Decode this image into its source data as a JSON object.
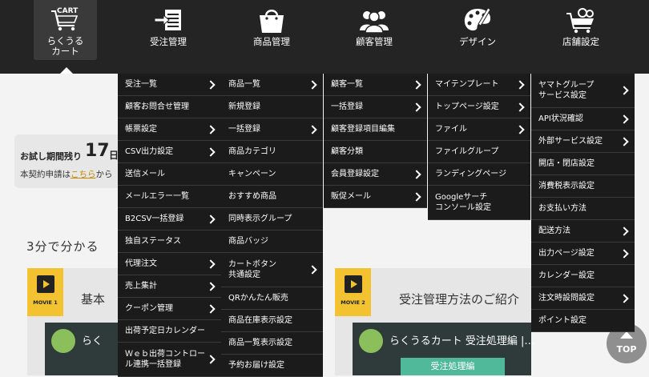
{
  "nav": [
    {
      "id": "cart",
      "label": "らくうる\nカート",
      "icon": "cart-icon",
      "icon_text": "CART"
    },
    {
      "id": "orders",
      "label": "受注管理",
      "icon": "order-import-icon"
    },
    {
      "id": "products",
      "label": "商品管理",
      "icon": "shopping-bag-icon"
    },
    {
      "id": "customers",
      "label": "顧客管理",
      "icon": "users-icon"
    },
    {
      "id": "design",
      "label": "デザイン",
      "icon": "palette-icon"
    },
    {
      "id": "store",
      "label": "店舗設定",
      "icon": "cart-settings-icon"
    }
  ],
  "menus": [
    {
      "id": "orders",
      "items": [
        {
          "label": "受注一覧",
          "arrow": true
        },
        {
          "label": "顧客お問合せ管理",
          "arrow": false
        },
        {
          "label": "帳票設定",
          "arrow": true
        },
        {
          "label": "CSV出力設定",
          "arrow": true
        },
        {
          "label": "送信メール",
          "arrow": false
        },
        {
          "label": "メールエラー一覧",
          "arrow": false
        },
        {
          "label": "B2CSV一括登録",
          "arrow": true
        },
        {
          "label": "独自ステータス",
          "arrow": false
        },
        {
          "label": "代理注文",
          "arrow": true
        },
        {
          "label": "売上集計",
          "arrow": true
        },
        {
          "label": "クーポン管理",
          "arrow": true
        },
        {
          "label": "出荷予定日カレンダー",
          "arrow": false
        },
        {
          "label": "Ｗｅｂ出荷コントロー\nル連携一括登録",
          "arrow": true,
          "tall": true
        }
      ]
    },
    {
      "id": "products",
      "items": [
        {
          "label": "商品一覧",
          "arrow": true
        },
        {
          "label": "新規登録",
          "arrow": false
        },
        {
          "label": "一括登録",
          "arrow": true
        },
        {
          "label": "商品カテゴリ",
          "arrow": false
        },
        {
          "label": "キャンペーン",
          "arrow": false
        },
        {
          "label": "おすすめ商品",
          "arrow": false
        },
        {
          "label": "同時表示グループ",
          "arrow": false
        },
        {
          "label": "商品バッジ",
          "arrow": false
        },
        {
          "label": "カートボタン\n共通設定",
          "arrow": true,
          "tall": true
        },
        {
          "label": "QRかんたん販売",
          "arrow": false
        },
        {
          "label": "商品在庫表示設定",
          "arrow": false
        },
        {
          "label": "商品一覧表示設定",
          "arrow": false
        },
        {
          "label": "予約お届け設定",
          "arrow": false
        }
      ]
    },
    {
      "id": "customers",
      "items": [
        {
          "label": "顧客一覧",
          "arrow": true
        },
        {
          "label": "一括登録",
          "arrow": true
        },
        {
          "label": "顧客登録項目編集",
          "arrow": false
        },
        {
          "label": "顧客分類",
          "arrow": false
        },
        {
          "label": "会員登録設定",
          "arrow": true
        },
        {
          "label": "販促メール",
          "arrow": true
        }
      ]
    },
    {
      "id": "design",
      "items": [
        {
          "label": "マイテンプレート",
          "arrow": true
        },
        {
          "label": "トップページ設定",
          "arrow": true
        },
        {
          "label": "ファイル",
          "arrow": true
        },
        {
          "label": "ファイルグループ",
          "arrow": false
        },
        {
          "label": "ランディングページ",
          "arrow": false
        },
        {
          "label": "Googleサーチ\nコンソール設定",
          "arrow": false,
          "tall": true
        }
      ]
    },
    {
      "id": "store",
      "items": [
        {
          "label": "ヤマトグループ\nサービス設定",
          "arrow": true,
          "tall": true
        },
        {
          "label": "API状況確認",
          "arrow": true
        },
        {
          "label": "外部サービス設定",
          "arrow": true
        },
        {
          "label": "開店・閉店設定",
          "arrow": false
        },
        {
          "label": "消費税表示設定",
          "arrow": false
        },
        {
          "label": "お支払い方法",
          "arrow": false
        },
        {
          "label": "配送方法",
          "arrow": true
        },
        {
          "label": "出力ページ設定",
          "arrow": true
        },
        {
          "label": "カレンダー設定",
          "arrow": false
        },
        {
          "label": "注文時設問設定",
          "arrow": true
        },
        {
          "label": "ポイント設定",
          "arrow": false
        }
      ]
    }
  ],
  "trial": {
    "days_label": "お試し期間残り",
    "days": "17",
    "unit": "日",
    "apply_prefix": "本契約申請は",
    "apply_link": "こちら",
    "apply_suffix": "から"
  },
  "section_title": "3分で分かる",
  "cards": [
    {
      "badge": "MOVIE 1",
      "title": "基本",
      "video_title": "らく",
      "video_button": ""
    },
    {
      "badge": "MOVIE 2",
      "title": "受注管理方法のご紹介",
      "video_title": "らくうるカート 受注処理編 |…",
      "video_button": "受注処理編"
    }
  ],
  "top_button": "TOP"
}
